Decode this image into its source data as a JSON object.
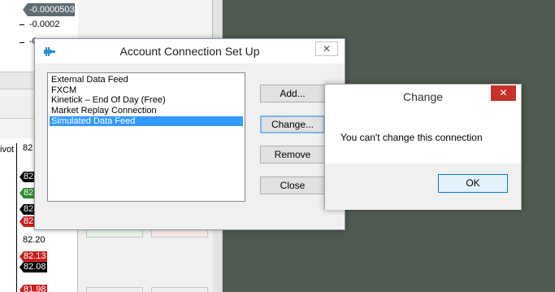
{
  "background": {
    "top_price_tag": "-0.0000503",
    "top_axis_labels": [
      "-0.0002",
      "-0."
    ],
    "pivot_label": "ivot",
    "price_tags": [
      {
        "text": "82",
        "color": "#000000"
      },
      {
        "text": "82",
        "color": "#000000"
      },
      {
        "text": "82",
        "color": "#2e8b2e"
      },
      {
        "text": "82",
        "color": "#000000"
      },
      {
        "text": "82",
        "color": "#cc1f1f"
      },
      {
        "text": "82.13",
        "color": "#cc1f1f"
      },
      {
        "text": "82.08",
        "color": "#000000"
      },
      {
        "text": "81.98",
        "color": "#cc1f1f"
      }
    ],
    "axis_labels": [
      "82",
      "82.20"
    ]
  },
  "account_dialog": {
    "title": "Account Connection Set Up",
    "close_label": "✕",
    "connections": [
      "External Data Feed",
      "FXCM",
      "Kinetick – End Of Day (Free)",
      "Market Replay Connection",
      "Simulated Data Feed"
    ],
    "selected_index": 4,
    "buttons": {
      "add": "Add...",
      "change": "Change...",
      "remove": "Remove",
      "close": "Close"
    }
  },
  "change_dialog": {
    "title": "Change",
    "close_label": "✕",
    "message": "You can't change this connection",
    "ok_label": "OK"
  },
  "colors": {
    "desktop_bg": "#4f5a50",
    "selection": "#3399ff",
    "close_red": "#c7312c",
    "ok_border": "#0078d7"
  }
}
